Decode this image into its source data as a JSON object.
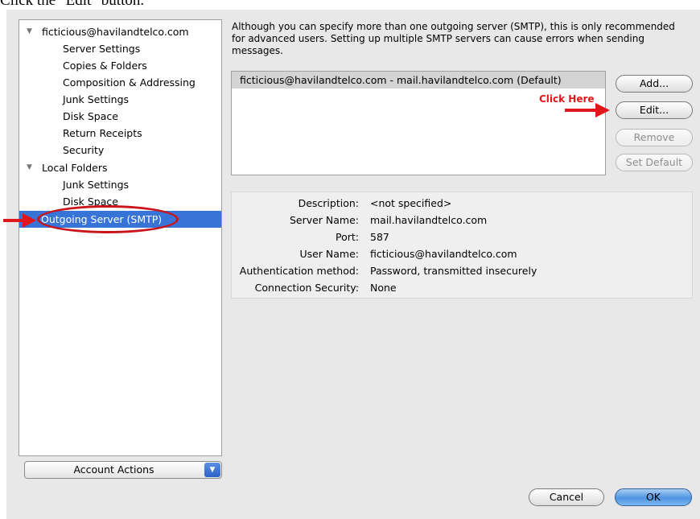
{
  "caption": "Click the \"Edit\" button.",
  "sidebar": {
    "items": [
      {
        "label": "ficticious@havilandtelco.com",
        "kind": "parent"
      },
      {
        "label": "Server Settings",
        "kind": "child"
      },
      {
        "label": "Copies & Folders",
        "kind": "child"
      },
      {
        "label": "Composition & Addressing",
        "kind": "child"
      },
      {
        "label": "Junk Settings",
        "kind": "child"
      },
      {
        "label": "Disk Space",
        "kind": "child"
      },
      {
        "label": "Return Receipts",
        "kind": "child"
      },
      {
        "label": "Security",
        "kind": "child"
      },
      {
        "label": "Local Folders",
        "kind": "parent"
      },
      {
        "label": "Junk Settings",
        "kind": "child"
      },
      {
        "label": "Disk Space",
        "kind": "child"
      },
      {
        "label": "Outgoing Server (SMTP)",
        "kind": "top",
        "selected": true
      }
    ],
    "account_actions": "Account Actions"
  },
  "notice": "Although you can specify more than one outgoing server (SMTP), this is only recommended for advanced users. Setting up multiple SMTP servers can cause errors when sending messages.",
  "server_list": {
    "rows": [
      "ficticious@havilandtelco.com - mail.havilandtelco.com (Default)"
    ]
  },
  "buttons": {
    "add": "Add...",
    "edit": "Edit...",
    "remove": "Remove",
    "set_default": "Set Default",
    "cancel": "Cancel",
    "ok": "OK"
  },
  "details": {
    "description_label": "Description:",
    "description_value": "<not specified>",
    "server_name_label": "Server Name:",
    "server_name_value": "mail.havilandtelco.com",
    "port_label": "Port:",
    "port_value": "587",
    "user_name_label": "User Name:",
    "user_name_value": "ficticious@havilandtelco.com",
    "auth_label": "Authentication method:",
    "auth_value": "Password, transmitted insecurely",
    "security_label": "Connection Security:",
    "security_value": "None"
  },
  "annotation": {
    "click_here": "Click Here",
    "color": "#e0161b"
  },
  "colors": {
    "selection": "#3874d7",
    "ok_button": "#4f95e3"
  }
}
